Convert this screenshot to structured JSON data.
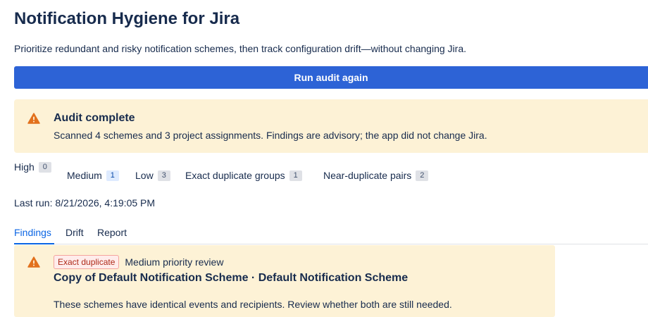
{
  "header": {
    "title": "Notification Hygiene for Jira",
    "subtitle": "Prioritize redundant and risky notification schemes, then track configuration drift—without changing Jira."
  },
  "actions": {
    "run_label": "Run audit again"
  },
  "banner": {
    "icon": "warning-icon",
    "heading": "Audit complete",
    "body": "Scanned 4 schemes and 3 project assignments. Findings are advisory; the app did not change Jira."
  },
  "stats": [
    {
      "label": "High",
      "count": "0"
    },
    {
      "label": "Medium",
      "count": "1"
    },
    {
      "label": "Low",
      "count": "3"
    },
    {
      "label": "Exact duplicate groups",
      "count": "1"
    },
    {
      "label": "Near-duplicate pairs",
      "count": "2"
    }
  ],
  "last_run": "Last run: 8/21/2026, 4:19:05 PM",
  "tabs": [
    {
      "label": "Findings",
      "active": true
    },
    {
      "label": "Drift",
      "active": false
    },
    {
      "label": "Report",
      "active": false
    }
  ],
  "findings": [
    {
      "icon": "warning-icon",
      "type": "Exact duplicate",
      "priority": "Medium priority review",
      "title": "Copy of Default Notification Scheme · Default Notification Scheme",
      "description": "These schemes have identical events and recipients. Review whether both are still needed."
    }
  ],
  "colors": {
    "primary": "#2d63d6",
    "warning_bg": "#fdf2d6",
    "warning_icon": "#e2711d",
    "tab_active": "#0c66e4",
    "danger_text": "#ae2a19"
  }
}
